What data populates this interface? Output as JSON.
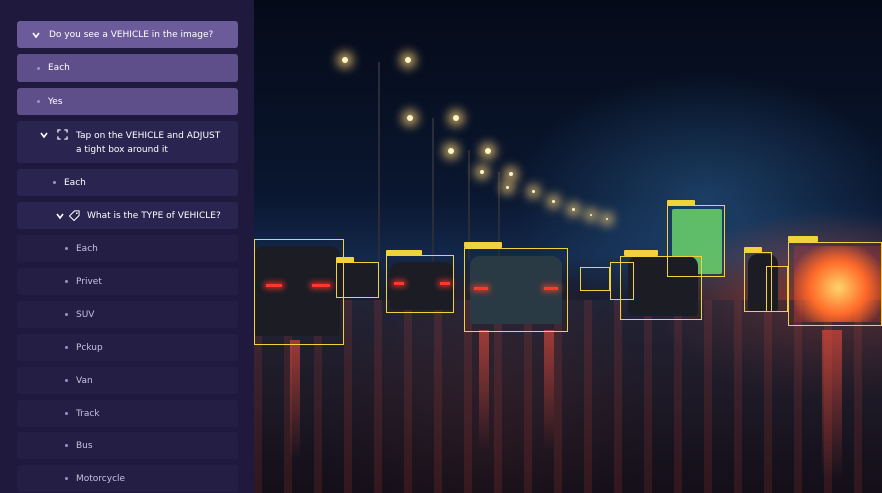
{
  "tree": {
    "q_vehicle": "Do you see a VEHICLE in the image?",
    "each_1": "Each",
    "yes": "Yes",
    "tap_line1": "Tap on the VEHICLE and ADJUST",
    "tap_line2": "a tight box around it",
    "each_2": "Each",
    "q_type": "What is the TYPE of VEHICLE?",
    "types": [
      "Each",
      "Privet",
      "SUV",
      "Pckup",
      "Van",
      "Track",
      "Bus",
      "Motorcycle"
    ]
  },
  "colors": {
    "bbox": "#f2d23c",
    "selected": "#6b5b9a",
    "row": "#2a2450"
  },
  "icons": {
    "chevron": "chevron-down-icon",
    "bbox_tool": "bounding-box-icon",
    "tag": "tag-icon"
  }
}
